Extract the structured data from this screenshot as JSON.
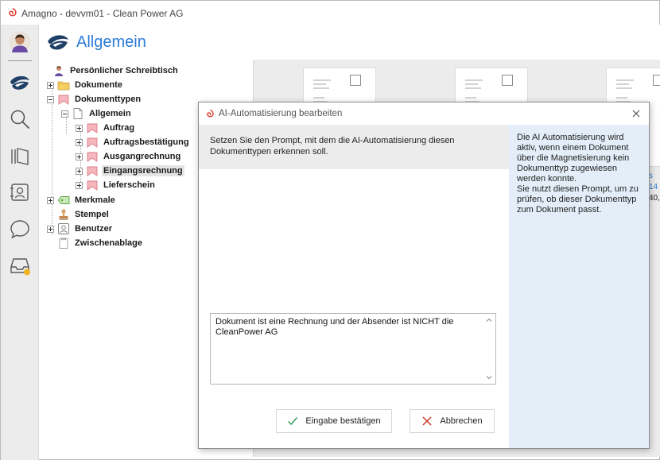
{
  "window": {
    "title": "Amagno - devvm01 - Clean Power AG"
  },
  "header": {
    "title": "Allgemein"
  },
  "nav": {
    "icons": [
      "avatar",
      "amagno-logo-icon",
      "search-icon",
      "library-icon",
      "contacts-icon",
      "chat-icon",
      "inbox-icon"
    ]
  },
  "tree": {
    "items": [
      {
        "label": "Persönlicher Schreibtisch",
        "icon": "person-icon"
      },
      {
        "label": "Dokumente",
        "icon": "folder-icon"
      },
      {
        "label": "Dokumenttypen",
        "icon": "bookmark-icon"
      },
      {
        "label": "Allgemein",
        "icon": "document-icon"
      },
      {
        "label": "Auftrag",
        "icon": "bookmark-icon"
      },
      {
        "label": "Auftragsbestätigung",
        "icon": "bookmark-icon"
      },
      {
        "label": "Ausgangrechnung",
        "icon": "bookmark-icon"
      },
      {
        "label": "Eingangsrechnung",
        "icon": "bookmark-icon"
      },
      {
        "label": "Lieferschein",
        "icon": "bookmark-icon"
      },
      {
        "label": "Merkmale",
        "icon": "tag-icon"
      },
      {
        "label": "Stempel",
        "icon": "stamp-icon"
      },
      {
        "label": "Benutzer",
        "icon": "user-icon"
      },
      {
        "label": "Zwischenablage",
        "icon": "clipboard-icon"
      }
    ]
  },
  "preview": {
    "edge_text_1": "s 14",
    "edge_text_2": "40,"
  },
  "dialog": {
    "title": "AI-Automatisierung bearbeiten",
    "prompt_label": "Setzen Sie den Prompt, mit dem die AI-Automatisierung diesen Dokumenttypen erkennen soll.",
    "info_text": "Die AI Automatisierung wird aktiv, wenn einem Dokument über die Magnetisierung kein Dokumenttyp zugewiesen werden konnte.\nSie nutzt diesen Prompt, um zu prüfen, ob dieser Dokumenttyp zum Dokument passt.",
    "prompt_value": "Dokument ist eine Rechnung und der Absender ist NICHT die CleanPower AG",
    "confirm_label": "Eingabe bestätigen",
    "cancel_label": "Abbrechen"
  },
  "colors": {
    "accent": "#2b7bd6",
    "confirm_check": "#3aa05a",
    "cancel_x": "#d0342c",
    "info_panel": "#e3eef8"
  }
}
